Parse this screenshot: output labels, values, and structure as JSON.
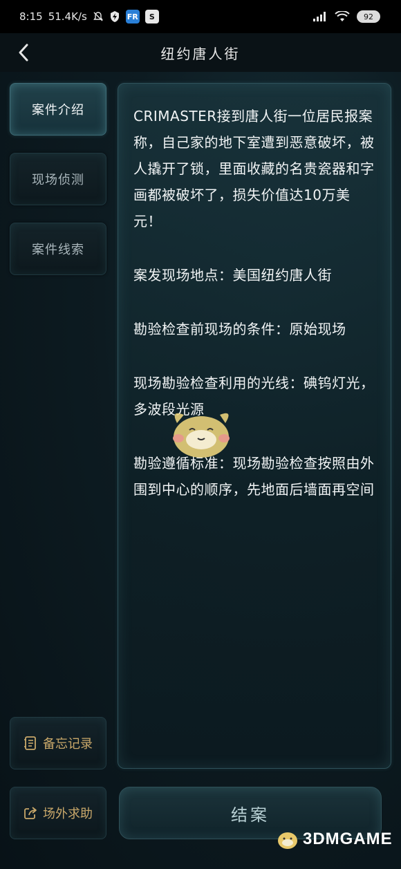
{
  "status_bar": {
    "time": "8:15",
    "speed": "51.4K/s",
    "battery": "92",
    "app_badge_1": "FR",
    "app_badge_2": "S"
  },
  "nav": {
    "title": "纽约唐人街"
  },
  "side_tabs": [
    {
      "label": "案件介绍",
      "active": true
    },
    {
      "label": "现场侦测",
      "active": false
    },
    {
      "label": "案件线索",
      "active": false
    }
  ],
  "side_utils": {
    "memo_label": "备忘记录",
    "help_label": "场外求助"
  },
  "content": {
    "paragraphs": [
      "CRIMASTER接到唐人街一位居民报案称，自己家的地下室遭到恶意破坏，被人撬开了锁，里面收藏的名贵瓷器和字画都被破坏了，损失价值达10万美元！",
      "案发现场地点：美国纽约唐人街",
      "勘验检查前现场的条件：原始现场",
      "现场勘验检查利用的光线：碘钨灯光，多波段光源",
      "勘验遵循标准：现场勘验检查按照由外围到中心的顺序，先地面后墙面再空间"
    ]
  },
  "close_case_label": "结案",
  "watermark": "3DMGAME",
  "colors": {
    "accent_gold": "#c9a86a",
    "panel_border": "#2f525b",
    "background": "#0d1b21"
  }
}
